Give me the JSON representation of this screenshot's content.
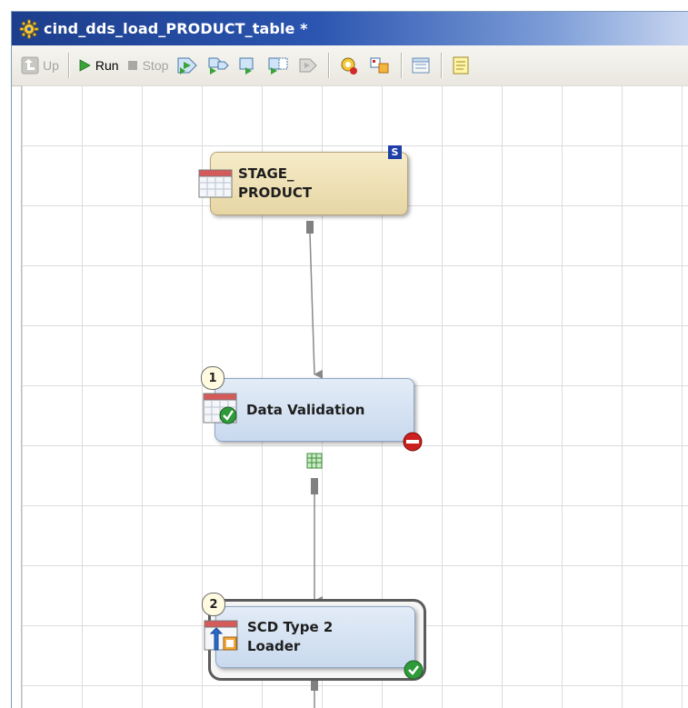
{
  "window": {
    "title": "cind_dds_load_PRODUCT_table *",
    "title_icon": "job-gear-icon"
  },
  "toolbar": {
    "up_label": "Up",
    "run_label": "Run",
    "stop_label": "Stop",
    "icons": [
      "run-from-selected-icon",
      "run-selected-icon",
      "step-icon",
      "continue-icon",
      "pause-icon",
      "properties-icon",
      "analyze-icon",
      "save-icon",
      "notes-icon"
    ]
  },
  "canvas": {
    "nodes": [
      {
        "id": "stage-product",
        "label": "STAGE_\nPRODUCT",
        "badge": "S",
        "kind": "table"
      },
      {
        "id": "data-validation",
        "label": "Data Validation",
        "order": "1",
        "status": "error"
      },
      {
        "id": "scd-type2-loader",
        "label": "SCD Type 2\nLoader",
        "order": "2",
        "status": "success"
      }
    ]
  },
  "colors": {
    "titlebar": "#1d3e8c",
    "table_node": "#efdfb2",
    "transform_node": "#d4e3f3",
    "error": "#cc1f1f",
    "success": "#2f9a3a"
  }
}
